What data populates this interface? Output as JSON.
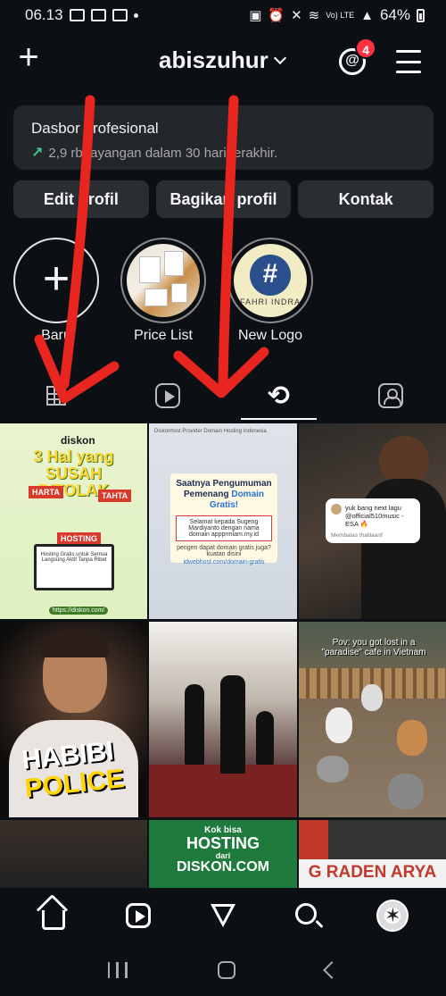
{
  "status_bar": {
    "time": "06.13",
    "network": "Vo) LTE",
    "battery": "64%"
  },
  "header": {
    "username": "abiszuhur",
    "threads_badge": "4"
  },
  "dashboard": {
    "title": "Dasbor profesional",
    "subtitle": "2,9 rb tayangan dalam 30 hari terakhir."
  },
  "actions": {
    "edit": "Edit profil",
    "share": "Bagikan profil",
    "contact": "Kontak"
  },
  "highlights": [
    {
      "label": "Baru"
    },
    {
      "label": "Price List"
    },
    {
      "label": "New Logo"
    }
  ],
  "highlight_logo": {
    "text": "FAHRI INDRA"
  },
  "tabs": [
    "grid-icon",
    "reels-icon",
    "repost-icon",
    "tagged-icon"
  ],
  "posts": {
    "p1": {
      "brand": "diskon",
      "headline": "3 Hal yang SUSAH DITOLAK",
      "tag1": "HARTA",
      "tag2": "TAHTA",
      "tag3": "HOSTING",
      "screen": "Hosting Gratis untuk Semua Langsung Aktif Tanpa Ribet",
      "url": "https://diskon.com/"
    },
    "p2": {
      "topbar": "Diskonhost  Provider Domain Hosting Indonesia",
      "heading": "Saatnya Pengumuman Pemenang",
      "heading_accent": "Domain Gratis!",
      "winner": "Selamat kepada Sugeng Mardiyanto dengan nama domain appprmiam.my.id",
      "question": "pengen dapat domain gratis juga? kuatan disini",
      "link": "idwebhost.com/domain-gratis"
    },
    "p3": {
      "comment": "yuk bang next lagu @official510music - ESA 🔥",
      "reply": "Membalas thalilaanf"
    },
    "p4": {
      "line1": "HABIBI",
      "line2": "POLICE"
    },
    "p6": {
      "caption": "Pov: you got lost in a \"paradise\" cafe in Vietnam"
    },
    "p8": {
      "line1": "Kok bisa",
      "line2": "HOSTING",
      "line3": "dari",
      "line4": "DISKON.COM"
    },
    "p9": {
      "banner": "G RADEN ARYA"
    }
  },
  "bottom_nav": [
    "home-icon",
    "reels-icon",
    "send-icon",
    "search-icon",
    "profile-avatar"
  ],
  "colors": {
    "background": "#0c1014",
    "card": "#23262b",
    "badge": "#ff3040",
    "trend": "#3ad28a",
    "annotation": "#e8261f"
  }
}
